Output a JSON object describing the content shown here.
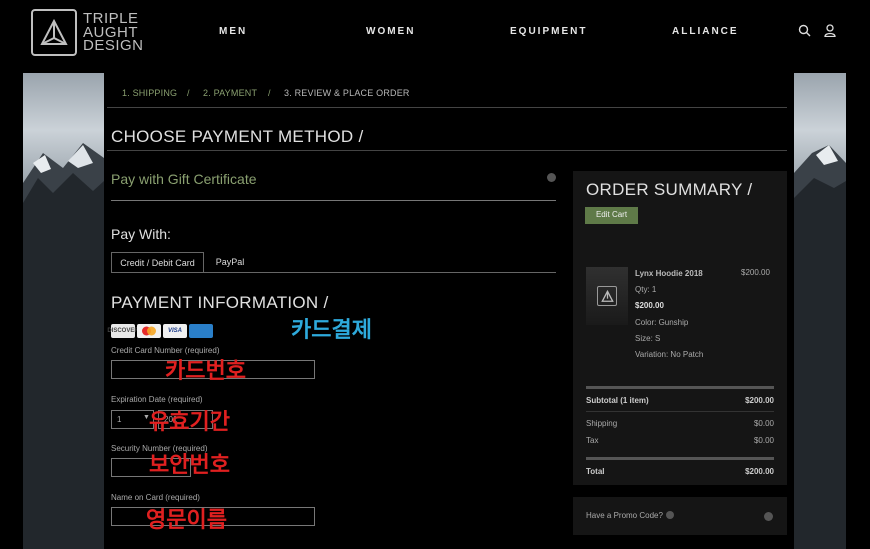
{
  "brand": {
    "line1": "TRIPLE",
    "line2": "AUGHT",
    "line3": "DESIGN"
  },
  "nav": {
    "men": "MEN",
    "women": "WOMEN",
    "equipment": "EQUIPMENT",
    "alliance": "ALLIANCE"
  },
  "icons": {
    "search": "search-icon",
    "account": "user-icon"
  },
  "breadcrumb": {
    "step1": "1. SHIPPING",
    "step2": "2. PAYMENT",
    "step3": "3. REVIEW & PLACE ORDER",
    "sep": "/"
  },
  "payment": {
    "heading": "CHOOSE PAYMENT METHOD /",
    "gift_certificate": "Pay with Gift Certificate",
    "pay_with": "Pay With:",
    "tab_card": "Credit / Debit Card",
    "tab_paypal": "PayPal",
    "info_heading": "PAYMENT INFORMATION  /",
    "card_logos": [
      "DISCOVER",
      "MasterCard",
      "VISA",
      "AMEX"
    ],
    "card_number_label": "Credit Card Number (required)",
    "card_number_value": "",
    "expiration_label": "Expiration Date (required)",
    "exp_month": "1",
    "exp_year": "201",
    "security_label": "Security Number (required)",
    "security_value": "",
    "name_label": "Name on Card (required)",
    "name_value": ""
  },
  "annotations": {
    "card_payment": "카드결제",
    "card_number": "카드번호",
    "expiration": "유효기간",
    "security": "보안번호",
    "english_name": "영문이름"
  },
  "summary": {
    "title": "ORDER SUMMARY  /",
    "edit_cart": "Edit Cart",
    "product_name": "Lynx Hoodie 2018",
    "product_price": "$200.00",
    "qty": "Qty: 1",
    "unit_price": "$200.00",
    "color": "Color: Gunship",
    "size": "Size: S",
    "variation": "Variation: No Patch",
    "subtotal_label": "Subtotal (1 item)",
    "subtotal_value": "$200.00",
    "shipping_label": "Shipping",
    "shipping_value": "$0.00",
    "tax_label": "Tax",
    "tax_value": "$0.00",
    "total_label": "Total",
    "total_value": "$200.00"
  },
  "promo": {
    "label": "Have a Promo Code?"
  },
  "colors": {
    "accent": "#8aa070",
    "button": "#5f7a48",
    "annotation_red": "#e02020",
    "annotation_blue": "#2eaadc"
  }
}
